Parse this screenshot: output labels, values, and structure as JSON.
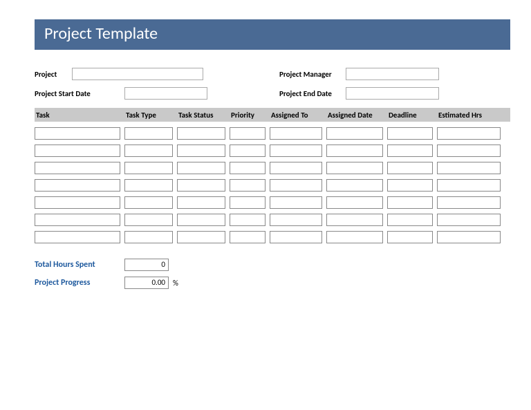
{
  "title": "Project Template",
  "meta": {
    "project_label": "Project",
    "project_value": "",
    "manager_label": "Project Manager",
    "manager_value": "",
    "start_label": "Project Start Date",
    "start_value": "",
    "end_label": "Project End Date",
    "end_value": ""
  },
  "columns": [
    "Task",
    "Task Type",
    "Task Status",
    "Priority",
    "Assigned To",
    "Assigned Date",
    "Deadline",
    "Estimated Hrs"
  ],
  "rows": [
    {
      "task": "",
      "type": "",
      "status": "",
      "priority": "",
      "assigned_to": "",
      "assigned_date": "",
      "deadline": "",
      "est_hrs": ""
    },
    {
      "task": "",
      "type": "",
      "status": "",
      "priority": "",
      "assigned_to": "",
      "assigned_date": "",
      "deadline": "",
      "est_hrs": ""
    },
    {
      "task": "",
      "type": "",
      "status": "",
      "priority": "",
      "assigned_to": "",
      "assigned_date": "",
      "deadline": "",
      "est_hrs": ""
    },
    {
      "task": "",
      "type": "",
      "status": "",
      "priority": "",
      "assigned_to": "",
      "assigned_date": "",
      "deadline": "",
      "est_hrs": ""
    },
    {
      "task": "",
      "type": "",
      "status": "",
      "priority": "",
      "assigned_to": "",
      "assigned_date": "",
      "deadline": "",
      "est_hrs": ""
    },
    {
      "task": "",
      "type": "",
      "status": "",
      "priority": "",
      "assigned_to": "",
      "assigned_date": "",
      "deadline": "",
      "est_hrs": ""
    },
    {
      "task": "",
      "type": "",
      "status": "",
      "priority": "",
      "assigned_to": "",
      "assigned_date": "",
      "deadline": "",
      "est_hrs": ""
    }
  ],
  "summary": {
    "hours_label": "Total Hours Spent",
    "hours_value": "0",
    "progress_label": "Project Progress",
    "progress_value": "0.00",
    "pct_symbol": "%"
  }
}
